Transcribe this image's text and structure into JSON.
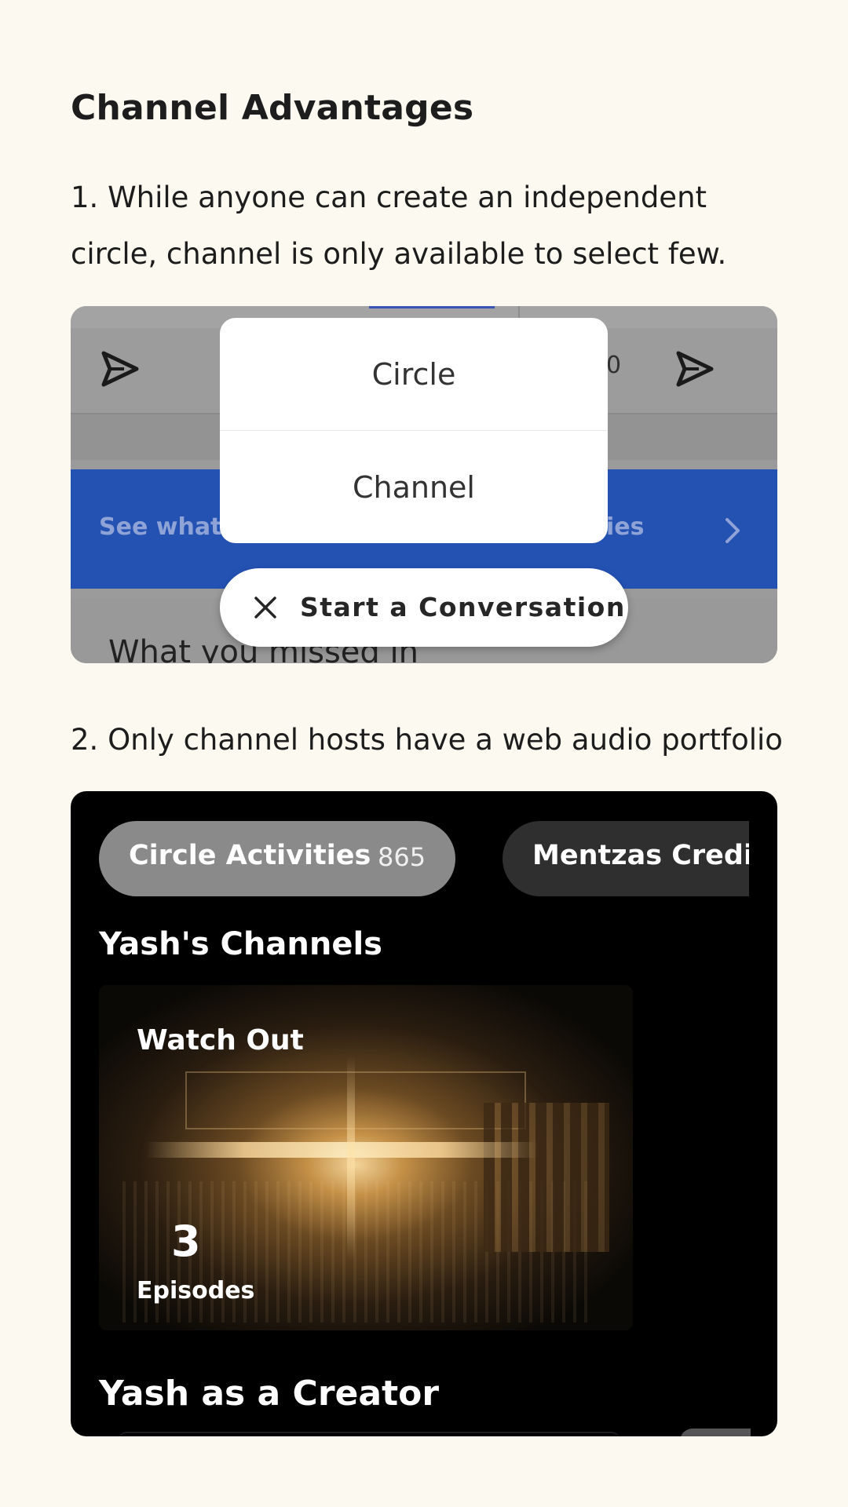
{
  "page": {
    "heading": "Channel Advantages",
    "point1": "1. While anyone can create an independent circle, channel is only available to select few.",
    "point2": "2. Only channel hosts have a web audio portfolio"
  },
  "shot1": {
    "counter_text": "0",
    "banner_left": "See what",
    "banner_right": "ies",
    "bottom_text": "What you missed in",
    "popup": {
      "items": [
        "Circle",
        "Channel"
      ]
    },
    "start_button": "Start a Conversation",
    "icons": [
      "send-icon",
      "close-icon",
      "chevron-right-icon"
    ],
    "colors": {
      "banner": "#2452b3",
      "overlay": "#9b9b9b"
    }
  },
  "shot2": {
    "chips": [
      {
        "label": "Circle Activities",
        "count": "865"
      },
      {
        "label": "Mentzas Credit"
      }
    ],
    "channels_title": "Yash's Channels",
    "card": {
      "title": "Watch Out",
      "episodes_count": "3",
      "episodes_label": "Episodes"
    },
    "creator_title": "Yash as a Creator"
  }
}
